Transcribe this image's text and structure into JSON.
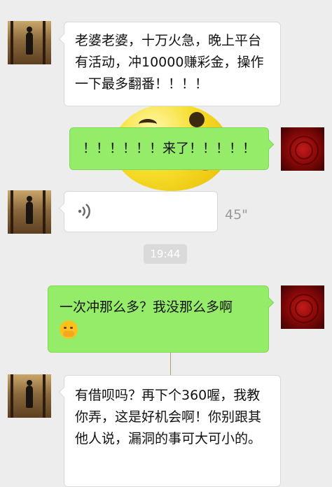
{
  "chat": {
    "messages": [
      {
        "sender": "left",
        "type": "text",
        "text": "老婆老婆，十万火急，晚上平台有活动，冲10000赚彩金，操作一下最多翻番！！！！"
      },
      {
        "sender": "right",
        "type": "text",
        "text": "！！！！！！来了！！！！！"
      },
      {
        "sender": "left",
        "type": "voice",
        "duration": "45\""
      },
      {
        "sender": "right",
        "type": "text",
        "text": "一次冲那么多？我没那么多啊",
        "emoji": "hugging-face-emoji"
      },
      {
        "sender": "left",
        "type": "text",
        "text": "有借呗吗？再下个360喔，我教你弄，这是好机会啊！你别跟其他人说，漏洞的事可大可小的。"
      }
    ],
    "timestamp": "19:44"
  },
  "colors": {
    "background": "#ededed",
    "sent_bubble": "#95ec69",
    "received_bubble": "#ffffff"
  }
}
